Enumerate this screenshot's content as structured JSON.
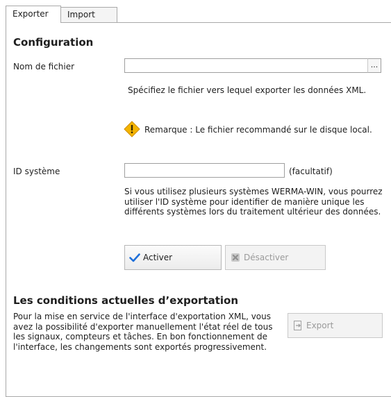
{
  "tabs": [
    {
      "label": "Exporter",
      "active": true
    },
    {
      "label": "Import",
      "active": false
    }
  ],
  "configuration": {
    "title": "Configuration",
    "filename_label": "Nom de fichier",
    "filename_value": "",
    "browse_label": "...",
    "filename_hint": "Spécifiez le fichier vers lequel exporter les données XML.",
    "remark": "Remarque : Le fichier recommandé sur le disque local.",
    "system_id_label": "ID système",
    "system_id_value": "",
    "optional_label": "(facultatif)",
    "system_id_hint": "Si vous utilisez plusieurs systèmes WERMA-WIN, vous pourrez utiliser l'ID système pour identifier de manière unique les différents systèmes lors du traitement ultérieur des données.",
    "activate_label": "Activer",
    "deactivate_label": "Désactiver"
  },
  "conditions": {
    "title": "Les conditions actuelles d’exportation",
    "description": "Pour la mise en service de l'interface d'exportation XML, vous avez la possibilité d'exporter manuellement l'état réel de tous les signaux, compteurs et tâches. En bon fonctionnement de l'interface, les changements sont exportés progressivement.",
    "export_label": "Export"
  },
  "colors": {
    "activate_check": "#1e6fd9",
    "warning_fill": "#f4b400"
  }
}
